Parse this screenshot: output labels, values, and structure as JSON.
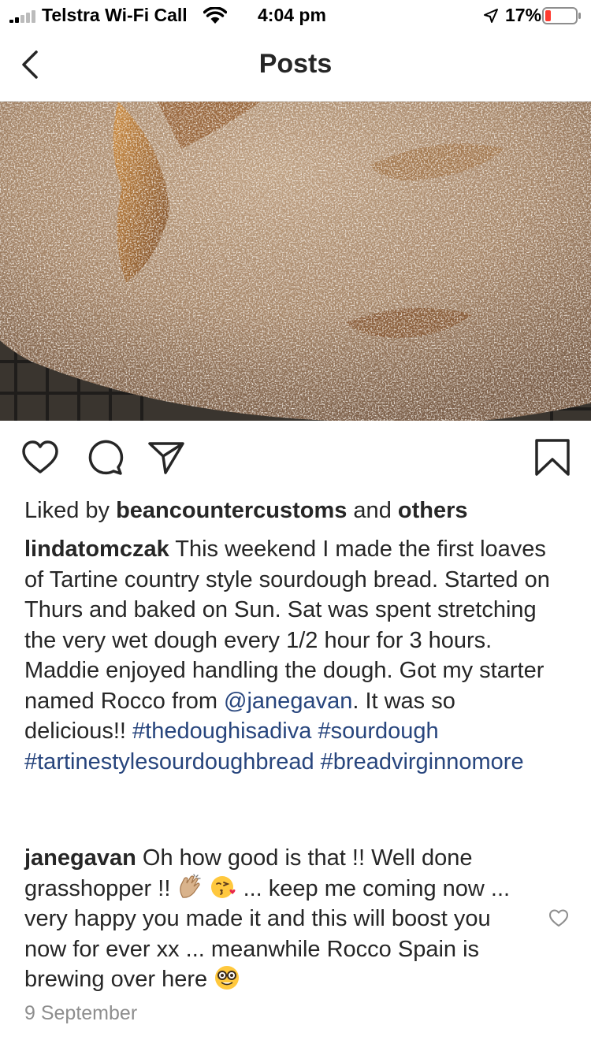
{
  "status_bar": {
    "carrier": "Telstra Wi-Fi Call",
    "time": "4:04 pm",
    "battery": "17%",
    "icons": [
      "signal-icon",
      "wifi-icon",
      "location-arrow-icon",
      "battery-icon"
    ]
  },
  "nav": {
    "title": "Posts",
    "back_icon": "chevron-left-icon"
  },
  "post": {
    "image": "sourdough-loaf-photo",
    "actions": [
      "heart-icon",
      "comment-icon",
      "share-icon",
      "bookmark-icon"
    ],
    "likes": {
      "prefix": "Liked by ",
      "user": "beancountercustoms",
      "middle": " and ",
      "others": "others"
    },
    "caption": {
      "user": "lindatomczak",
      "text1": " This weekend I made the first loaves of Tartine country style sourdough bread.  Started on Thurs and baked on Sun.  Sat was spent stretching the very wet dough every 1/2 hour for 3 hours.  Maddie enjoyed handling the dough. Got my starter named Rocco from ",
      "mention": "@janegavan",
      "text2": ". It was so delicious!! ",
      "hashtag1": "#thedoughisadiva",
      "hashtag2": "#sourdough",
      "hashtag3": "#tartinestylesourdoughbread",
      "hashtag4": "#breadvirginnomore"
    },
    "comment": {
      "user": "janegavan",
      "text1": " Oh how good is that !! Well done grasshopper !! ",
      "text2": " ... keep me coming now ... very happy you made it and this will boost you now for ever xx ... meanwhile Rocco Spain is brewing over here ",
      "emojis": [
        "clapping-hands-emoji",
        "face-blowing-kiss-emoji",
        "nerd-face-emoji"
      ],
      "like_icon": "heart-outline-icon"
    },
    "date": "9 September"
  },
  "colors": {
    "text": "#262626",
    "hashtag": "#27457d",
    "muted": "#8e8e8e",
    "battery_low": "#ff3b30"
  }
}
